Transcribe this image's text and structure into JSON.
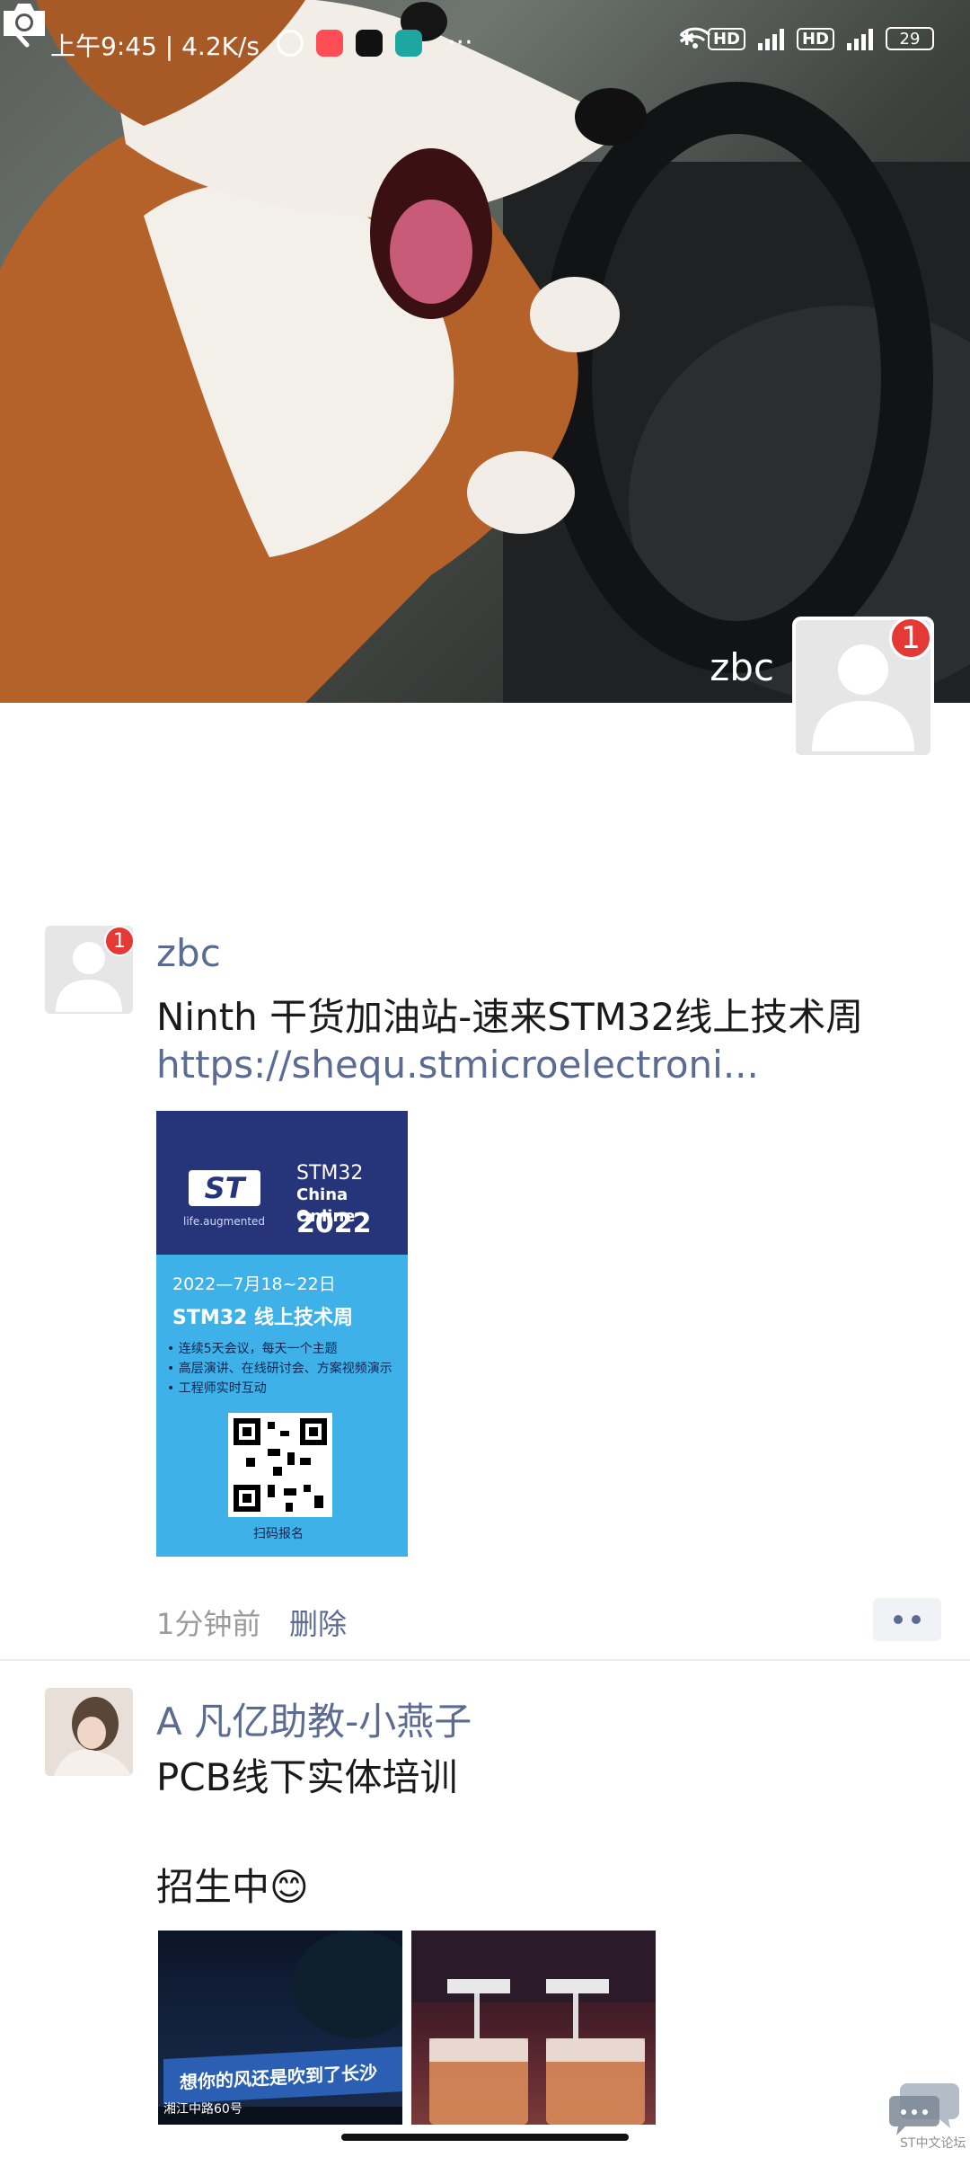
{
  "status_bar": {
    "time": "上午9:45 | 4.2K/s",
    "more": "···",
    "hd1": "HD",
    "hd2": "HD",
    "battery": "29"
  },
  "header": {
    "back_icon": "back-icon",
    "camera_icon": "camera-icon"
  },
  "cover": {
    "user_name": "zbc",
    "badge_count": "1"
  },
  "posts": [
    {
      "author": "zbc",
      "badge_count": "1",
      "text": "Ninth  干货加油站-速来STM32线上技术周",
      "link": "https://shequ.stmicroelectroni...",
      "poster": {
        "logo": "ST",
        "tagline": "life.augmented",
        "event_line1": "STM32",
        "event_line2": "China Online",
        "event_year": "2022",
        "date": "2022—7月18~22日",
        "title": "STM32 线上技术周",
        "bullets": [
          "• 连续5天会议，每天一个主题",
          "• 高层演讲、在线研讨会、方案视频演示",
          "• 工程师实时互动"
        ],
        "scan_label": "扫码报名"
      },
      "time": "1分钟前",
      "delete_label": "删除"
    },
    {
      "author": "A  凡亿助教-小燕子",
      "line1": "PCB线下实体培训",
      "line2": "招生中😊",
      "image1_sign": "想你的风还是吹到了长沙",
      "image1_sub": "湘江中路60号"
    }
  ],
  "watermark_label": "ST中文论坛",
  "colors": {
    "link": "#5b6b92",
    "badge": "#e53935",
    "more_bg": "#f1f2f5"
  }
}
